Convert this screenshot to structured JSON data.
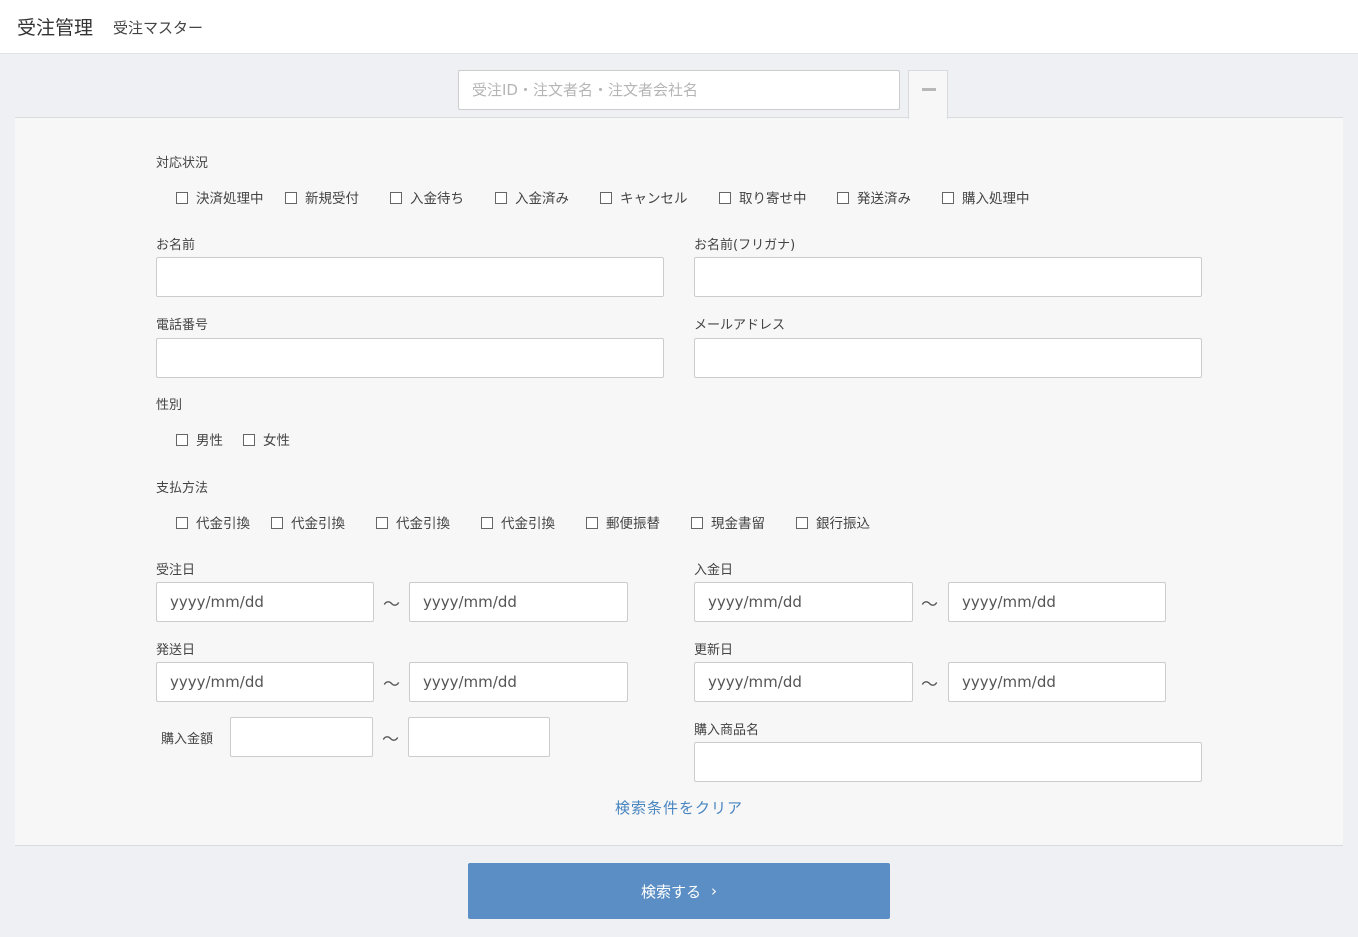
{
  "header": {
    "title": "受注管理",
    "subtitle": "受注マスター"
  },
  "search": {
    "placeholder": "受注ID・注文者名・注文者会社名"
  },
  "status": {
    "label": "対応状況",
    "options": [
      "決済処理中",
      "新規受付",
      "入金待ち",
      "入金済み",
      "キャンセル",
      "取り寄せ中",
      "発送済み",
      "購入処理中"
    ]
  },
  "name": {
    "label": "お名前"
  },
  "kana": {
    "label": "お名前(フリガナ)"
  },
  "phone": {
    "label": "電話番号"
  },
  "email": {
    "label": "メールアドレス"
  },
  "gender": {
    "label": "性別",
    "options": [
      "男性",
      "女性"
    ]
  },
  "payment": {
    "label": "支払方法",
    "options": [
      "代金引換",
      "代金引換",
      "代金引換",
      "代金引換",
      "郵便振替",
      "現金書留",
      "銀行振込"
    ]
  },
  "date_placeholder": "yyyy/mm/dd",
  "tilde": "〜",
  "order_date": {
    "label": "受注日"
  },
  "payment_date": {
    "label": "入金日"
  },
  "ship_date": {
    "label": "発送日"
  },
  "update_date": {
    "label": "更新日"
  },
  "amount": {
    "label": "購入金額"
  },
  "product": {
    "label": "購入商品名"
  },
  "clear_label": "検索条件をクリア",
  "submit_label": "検索する",
  "submit_chevron": "›"
}
